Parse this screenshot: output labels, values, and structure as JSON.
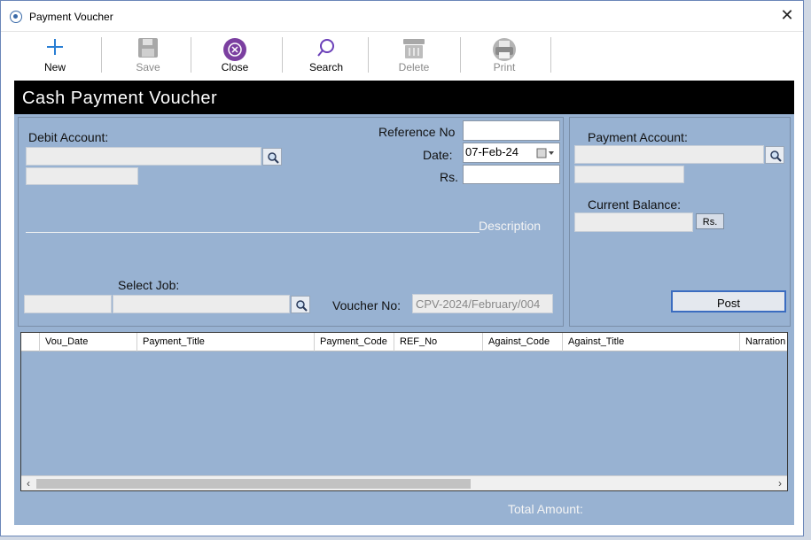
{
  "window": {
    "title": "Payment Voucher",
    "close_glyph": "✕"
  },
  "toolbar": {
    "new_label": "New",
    "save_label": "Save",
    "close_label": "Close",
    "search_label": "Search",
    "delete_label": "Delete",
    "print_label": "Print"
  },
  "header": {
    "title": "Cash Payment Voucher"
  },
  "form": {
    "debit_account_label": "Debit Account:",
    "reference_no_label": "Reference No",
    "reference_no_value": "",
    "date_label": "Date:",
    "date_value": "07-Feb-24",
    "rs_label": "Rs.",
    "rs_value": "",
    "description_label": "Description",
    "select_job_label": "Select Job:",
    "voucher_no_label": "Voucher No:",
    "voucher_no_value": "CPV-2024/February/004"
  },
  "payment_panel": {
    "payment_account_label": "Payment Account:",
    "current_balance_label": "Current Balance:",
    "rs_button_label": "Rs.",
    "post_button_label": "Post"
  },
  "grid": {
    "columns": [
      "Vou_Date",
      "Payment_Title",
      "Payment_Code",
      "REF_No",
      "Against_Code",
      "Against_Title",
      "Narration"
    ]
  },
  "footer": {
    "total_amount_label": "Total Amount:"
  },
  "colors": {
    "panel_bg": "#98b2d2",
    "header_bg": "#000000",
    "close_icon": "#7b3fa0",
    "accent": "#3b6cc0"
  }
}
